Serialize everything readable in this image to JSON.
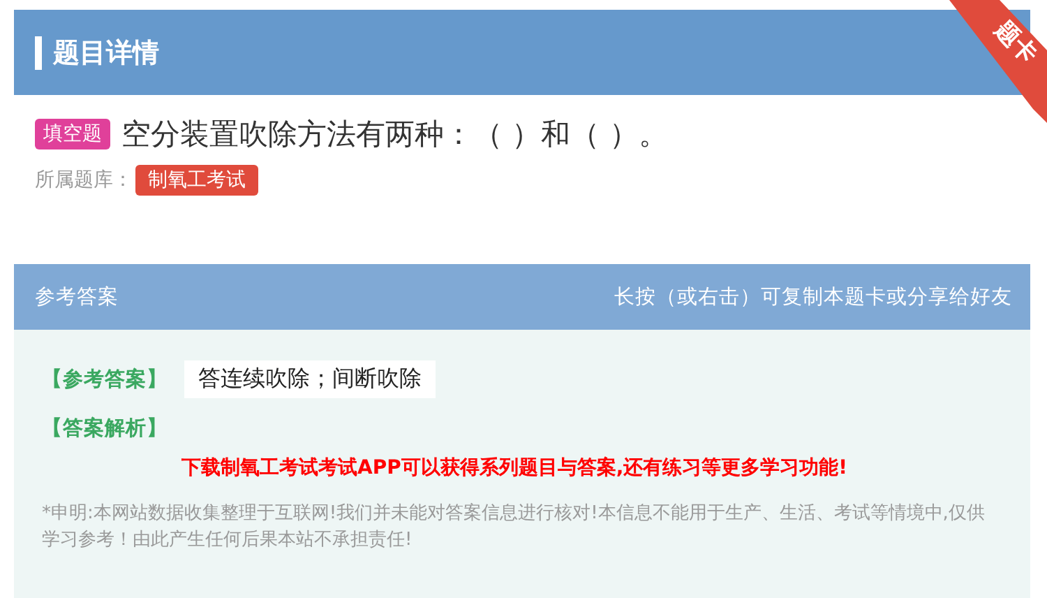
{
  "header": {
    "title": "题目详情",
    "ribbon": "题卡"
  },
  "question": {
    "type_tag": "填空题",
    "text": "空分装置吹除方法有两种：（  ）和（  ）。",
    "bank_label": "所属题库：",
    "bank": "制氧工考试"
  },
  "answer_bar": {
    "title": "参考答案",
    "hint": "长按（或右击）可复制本题卡或分享给好友"
  },
  "answer": {
    "answer_label": "【参考答案】",
    "answer_text": "答连续吹除；间断吹除",
    "analysis_label": "【答案解析】",
    "promo": "下载制氧工考试考试APP可以获得系列题目与答案,还有练习等更多学习功能!",
    "disclaimer": "*申明:本网站数据收集整理于互联网!我们并未能对答案信息进行核对!本信息不能用于生产、生活、考试等情境中,仅供学习参考！由此产生任何后果本站不承担责任!"
  }
}
